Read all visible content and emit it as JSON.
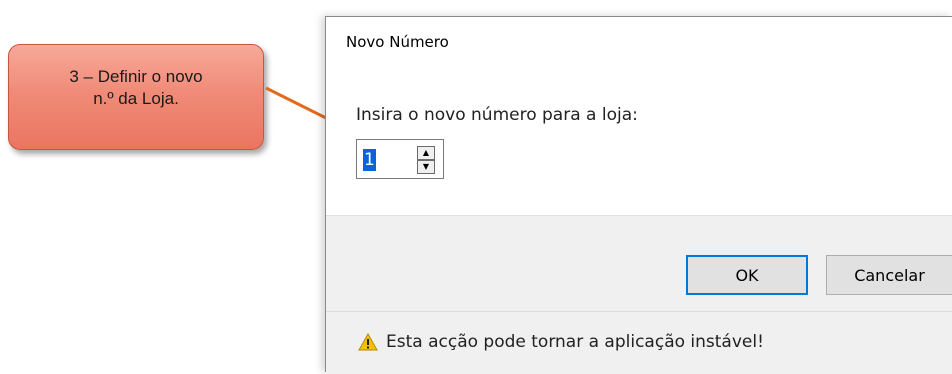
{
  "callout": {
    "text": "3 – Definir o novo\nn.º da Loja.",
    "fill": "#f08b78",
    "border": "#c9543f"
  },
  "arrow": {
    "color": "#e06a1e"
  },
  "dialog": {
    "title": "Novo Número",
    "prompt": "Insira o novo número para a loja:",
    "spinner": {
      "value": "1",
      "up_icon": "triangle-up",
      "down_icon": "triangle-down"
    },
    "buttons": {
      "ok_label": "OK",
      "cancel_label": "Cancelar"
    },
    "warning": {
      "icon": "warning-icon",
      "text": "Esta acção pode tornar a aplicação instável!",
      "icon_color": "#f2c200"
    },
    "accent": "#0078d7",
    "selection_color": "#0a64d8"
  }
}
